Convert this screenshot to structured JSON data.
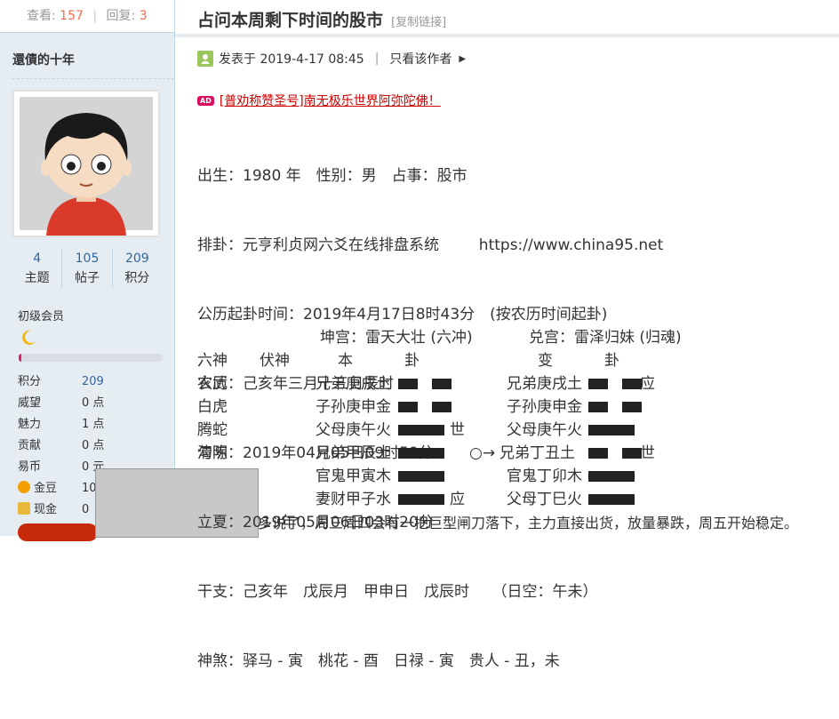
{
  "thread_stats": {
    "views_label": "查看:",
    "views": "157",
    "replies_label": "回复:",
    "replies": "3",
    "separator": "|"
  },
  "user": {
    "name": "還債的十年",
    "stats": [
      {
        "value": "4",
        "label": "主题"
      },
      {
        "value": "105",
        "label": "帖子"
      },
      {
        "value": "209",
        "label": "积分"
      }
    ],
    "level": "初级会员",
    "level_progress": 0.02,
    "properties": [
      {
        "key": "积分",
        "value": "209"
      },
      {
        "key": "威望",
        "value": "0 点"
      },
      {
        "key": "魅力",
        "value": "1 点"
      },
      {
        "key": "贡献",
        "value": "0 点"
      },
      {
        "key": "易币",
        "value": "0 元"
      },
      {
        "key": "金豆",
        "value": "10"
      },
      {
        "key": "现金",
        "value": "0"
      }
    ]
  },
  "post": {
    "title": "占问本周剩下时间的股市",
    "copy_link": "[复制链接]",
    "posted_at": "发表于 2019-4-17 08:45",
    "separator": "|",
    "author_only": "只看该作者",
    "ad": {
      "tag": "AD",
      "label": "[普劝称赞圣号]",
      "message": "南无极乐世界阿弥陀佛！"
    },
    "lines": [
      "出生：1980 年　性别：男　占事：股市",
      "排卦：元亨利贞网六爻在线排盘系统　　  https://www.china95.net",
      "公历起卦时间：2019年4月17日8时43分　(按农历时间起卦)",
      "农历：己亥年三月十三日辰时",
      "清明：2019年04月05日09时59分",
      "立夏：2019年05月06日03时20分",
      "干支：己亥年　戊辰月　甲申日　戊辰时　　（日空：午未）",
      "神煞：驿马 - 寅　桃花 - 酉　日禄 - 寅　贵人 - 丑，未"
    ],
    "hexagram": {
      "palace_main": "坤宫：雷天大壮 (六冲)",
      "palace_change": "兑宫：雷泽归妹 (归魂)",
      "headers": [
        "六神",
        "伏神",
        "本",
        "卦",
        "变",
        "卦"
      ],
      "rows": [
        {
          "spirit": "玄武",
          "main": "兄弟庚戌土",
          "main_yin": true,
          "main_mark": "",
          "moving": "",
          "change": "兄弟庚戌土",
          "change_yin": true,
          "change_mark": "应"
        },
        {
          "spirit": "白虎",
          "main": "子孙庚申金",
          "main_yin": true,
          "main_mark": "",
          "moving": "",
          "change": "子孙庚申金",
          "change_yin": true,
          "change_mark": ""
        },
        {
          "spirit": "腾蛇",
          "main": "父母庚午火",
          "main_yin": false,
          "main_mark": "世",
          "moving": "",
          "change": "父母庚午火",
          "change_yin": false,
          "change_mark": ""
        },
        {
          "spirit": "勾陈",
          "main": "兄弟甲辰土",
          "main_yin": false,
          "main_mark": "",
          "moving": "○→",
          "change": "兄弟丁丑土",
          "change_yin": true,
          "change_mark": "世"
        },
        {
          "spirit": "",
          "main": "官鬼甲寅木",
          "main_yin": false,
          "main_mark": "",
          "moving": "",
          "change": "官鬼丁卯木",
          "change_yin": false,
          "change_mark": ""
        },
        {
          "spirit": "",
          "main": "妻财甲子水",
          "main_yin": false,
          "main_mark": "应",
          "moving": "",
          "change": "父母丁巳火",
          "change_yin": false,
          "change_mark": ""
        }
      ]
    },
    "final_line": "多说了，周三周四会有一把巨型闸刀落下，主力直接出货，放量暴跌，周五开始稳定。"
  },
  "colors": {
    "sidebar_bg": "#e5edf2",
    "accent_red": "#f26c4f",
    "link_blue": "#336699",
    "ad_red": "#cc0000"
  }
}
